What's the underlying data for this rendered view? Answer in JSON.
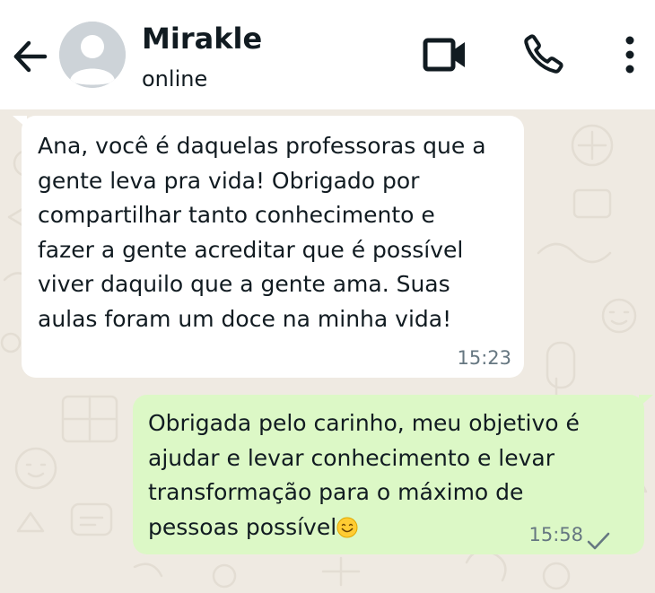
{
  "header": {
    "contact_name": "Mirakle",
    "status": "online",
    "icons": [
      "arrow-left-icon",
      "avatar-placeholder-icon",
      "video-camera-icon",
      "phone-icon",
      "more-vertical-icon"
    ]
  },
  "messages": [
    {
      "direction": "incoming",
      "text": "Ana, você é daquelas professoras que a\ngente leva pra vida! Obrigado por\ncompartilhar tanto conhecimento e\nfazer a gente acreditar que é possível\nviver daquilo que a gente ama. Suas\naulas foram um doce na minha vida!",
      "time": "15:23"
    },
    {
      "direction": "outgoing",
      "text": "Obrigada pelo carinho, meu objetivo é\najudar e levar conhecimento e levar\ntransformação para o máximo de\npessoas possível",
      "emoji": "smiling-face-icon",
      "time": "15:58",
      "status": "sent-check-icon"
    }
  ],
  "colors": {
    "header_bg": "#ffffff",
    "chat_bg": "#efeae2",
    "incoming_bubble": "#ffffff",
    "outgoing_bubble": "#dcf8c6",
    "text": "#111b21",
    "meta_text": "#667781"
  }
}
